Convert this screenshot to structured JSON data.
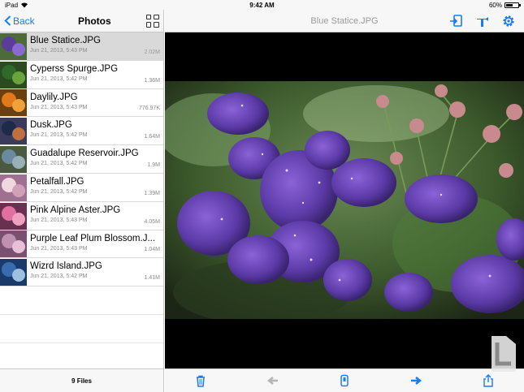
{
  "status": {
    "carrier": "iPad",
    "time": "9:42 AM",
    "battery": "60%",
    "battery_level": 0.6
  },
  "left": {
    "back_label": "Back",
    "title": "Photos",
    "footer": "9 Files",
    "files": [
      {
        "name": "Blue Statice.JPG",
        "date": "Jun 21, 2013, 5:43 PM",
        "size": "2.02M",
        "selected": true
      },
      {
        "name": "Cyperss Spurge.JPG",
        "date": "Jun 21, 2013, 5:42 PM",
        "size": "1.36M"
      },
      {
        "name": "Daylily.JPG",
        "date": "Jun 21, 2013, 5:43 PM",
        "size": "776.97K"
      },
      {
        "name": "Dusk.JPG",
        "date": "Jun 21, 2013, 5:42 PM",
        "size": "1.64M"
      },
      {
        "name": "Guadalupe Reservoir.JPG",
        "date": "Jun 21, 2013, 5:42 PM",
        "size": "1.9M"
      },
      {
        "name": "Petalfall.JPG",
        "date": "Jun 21, 2013, 5:42 PM",
        "size": "1.39M"
      },
      {
        "name": "Pink Alpine Aster.JPG",
        "date": "Jun 21, 2013, 5:43 PM",
        "size": "4.05M"
      },
      {
        "name": "Purple Leaf Plum Blossom.J...",
        "date": "Jun 21, 2013, 5:43 PM",
        "size": "1.04M"
      },
      {
        "name": "Wizrd Island.JPG",
        "date": "Jun 21, 2013, 5:42 PM",
        "size": "1.41M"
      }
    ]
  },
  "viewer": {
    "title": "Blue Statice.JPG"
  },
  "colors": {
    "accent": "#1a7cf5",
    "toolbar": "#f7f7f7",
    "selected_row": "#d9d9d9"
  },
  "icons": {
    "nav": [
      "export-to-app-icon",
      "open-with-icon",
      "settings-gear-icon"
    ],
    "toolbar": [
      "trash-icon",
      "previous-arrow-icon",
      "slideshow-icon",
      "next-arrow-icon",
      "share-icon"
    ]
  }
}
